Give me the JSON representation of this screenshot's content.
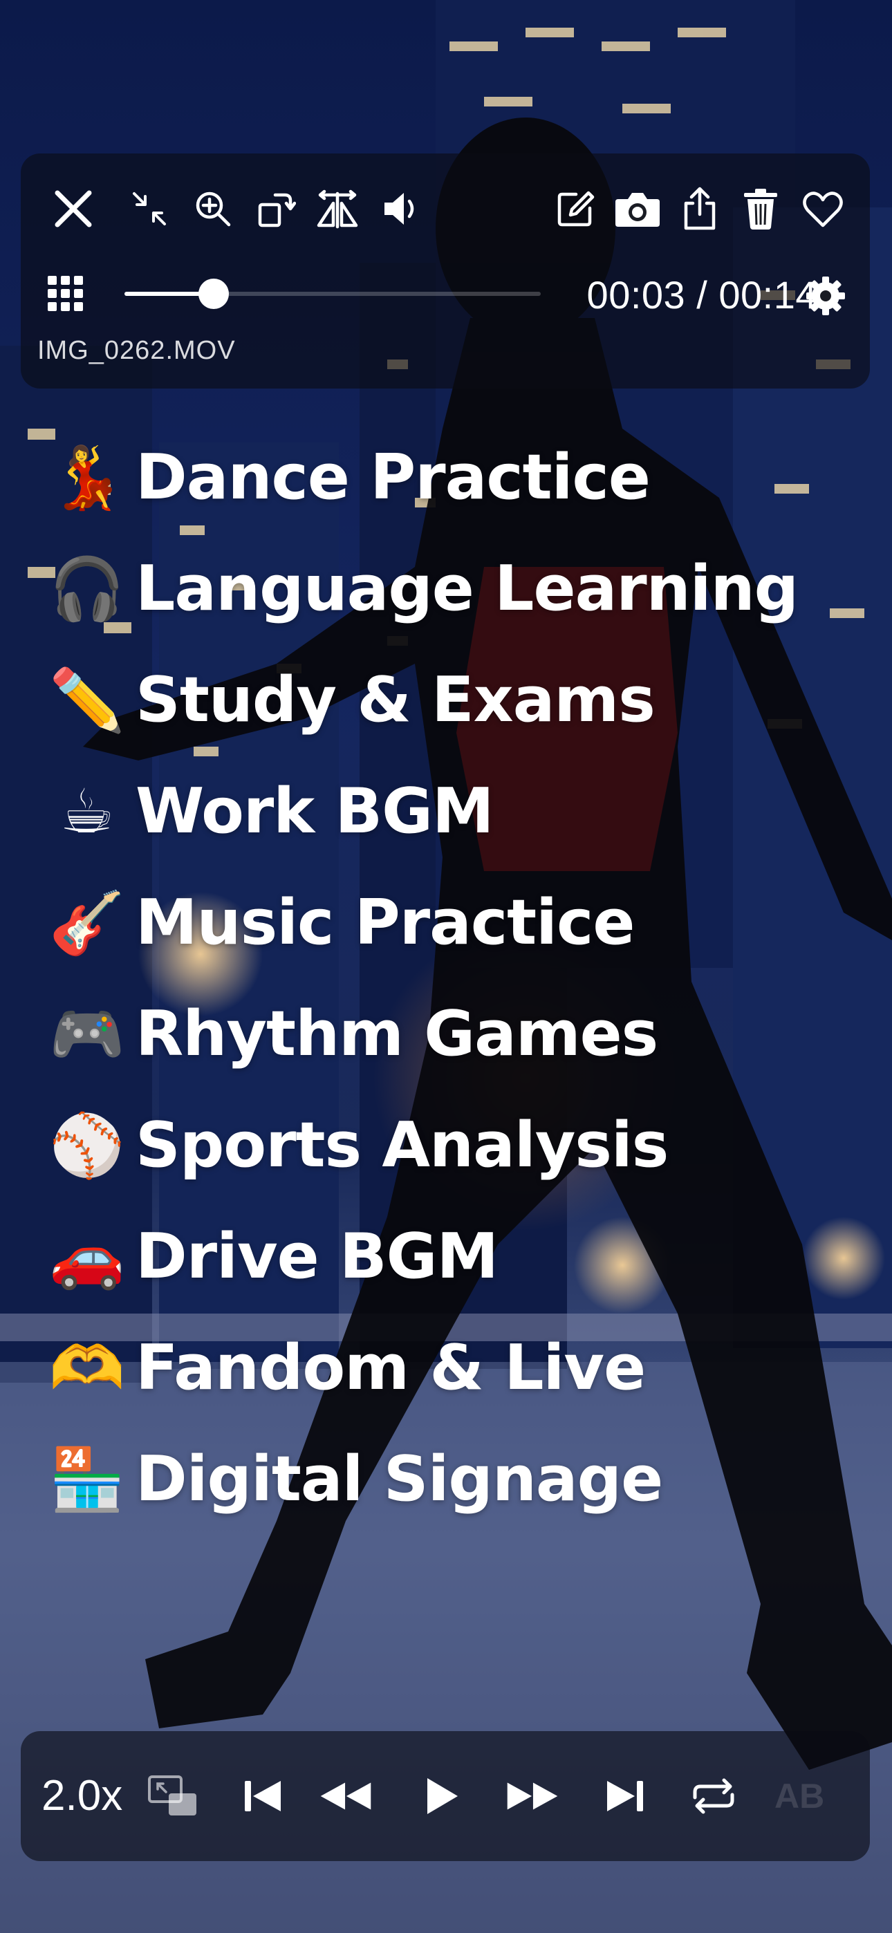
{
  "player": {
    "filename": "IMG_0262.MOV",
    "time_display": "00:03 / 00:14",
    "progress_fraction": 0.214,
    "speed": "2.0x",
    "ab_label": "AB"
  },
  "top_toolbar_icons": [
    "close-icon",
    "shrink-icon",
    "zoom-in-icon",
    "rotate-icon",
    "flip-icon",
    "volume-icon",
    "edit-icon",
    "camera-icon",
    "share-icon",
    "trash-icon",
    "heart-icon"
  ],
  "features": [
    {
      "emoji": "💃",
      "label": "Dance Practice"
    },
    {
      "emoji": "🎧",
      "label": "Language Learning"
    },
    {
      "emoji": "✏️",
      "label": "Study & Exams"
    },
    {
      "emoji": "☕",
      "label": "Work BGM"
    },
    {
      "emoji": "🎸",
      "label": "Music Practice"
    },
    {
      "emoji": "🎮",
      "label": "Rhythm Games"
    },
    {
      "emoji": "⚾",
      "label": "Sports Analysis"
    },
    {
      "emoji": "🚗",
      "label": "Drive BGM"
    },
    {
      "emoji": "🫶",
      "label": "Fandom & Live"
    },
    {
      "emoji": "🏪",
      "label": "Digital Signage"
    }
  ]
}
